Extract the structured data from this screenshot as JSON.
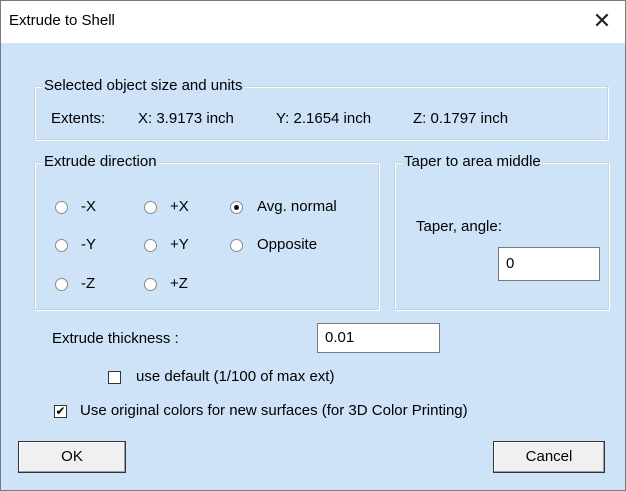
{
  "window": {
    "title": "Extrude to Shell"
  },
  "size_group": {
    "legend": "Selected object size and units",
    "extents_label": "Extents:",
    "x_extent": "X: 3.9173 inch",
    "y_extent": "Y: 2.1654 inch",
    "z_extent": "Z: 0.1797 inch"
  },
  "direction_group": {
    "legend": "Extrude direction",
    "options": [
      "-X",
      "+X",
      "Avg. normal",
      "-Y",
      "+Y",
      "Opposite",
      "-Z",
      "+Z"
    ],
    "selected": "Avg. normal"
  },
  "taper_group": {
    "legend": "Taper to area middle",
    "angle_label": "Taper, angle:",
    "angle_value": "0"
  },
  "thickness": {
    "label": "Extrude thickness :",
    "value": "0.01"
  },
  "use_default": {
    "label": "use default (1/100 of max ext)",
    "checked": false
  },
  "use_original_colors": {
    "label": "Use original colors for new surfaces (for 3D Color Printing)",
    "checked": true
  },
  "buttons": {
    "ok": "OK",
    "cancel": "Cancel"
  }
}
